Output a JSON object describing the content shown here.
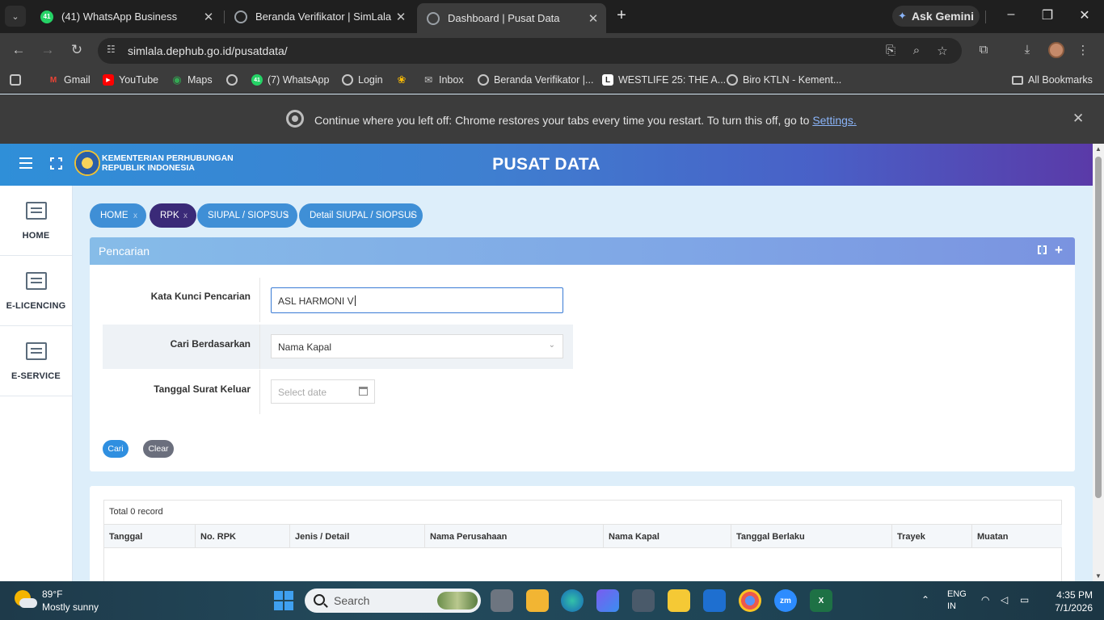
{
  "browser": {
    "tabs": [
      {
        "title": "(41) WhatsApp Business",
        "badge": "41",
        "color": "#25d366",
        "active": false
      },
      {
        "title": "Beranda Verifikator | SimLala",
        "color": "#8c8c8c",
        "active": false
      },
      {
        "title": "Dashboard | Pusat Data",
        "color": "#8c8c8c",
        "active": true
      }
    ],
    "ask_gemini": "Ask Gemini",
    "url": "simlala.dephub.go.id/pusatdata/",
    "bookmarks": [
      {
        "label": "Gmail",
        "icon": "gmail-icon",
        "color": "#ea4335"
      },
      {
        "label": "YouTube",
        "icon": "youtube-icon",
        "color": "#ff0000"
      },
      {
        "label": "Maps",
        "icon": "maps-icon",
        "color": "#34a853"
      },
      {
        "label": "",
        "icon": "globe-icon",
        "color": "#9aa0a6"
      },
      {
        "label": "(7) WhatsApp",
        "icon": "whatsapp-icon",
        "color": "#25d366",
        "badge": "41"
      },
      {
        "label": "Login",
        "icon": "globe-icon",
        "color": "#9aa0a6"
      },
      {
        "label": "",
        "icon": "pinwheel-icon",
        "color": "#fbbc04"
      },
      {
        "label": "Inbox",
        "icon": "mail-icon",
        "color": "#9aa0a6"
      },
      {
        "label": "Beranda Verifikator |...",
        "icon": "globe-icon",
        "color": "#9aa0a6"
      },
      {
        "label": "WESTLIFE 25: THE A...",
        "icon": "l-logo-icon",
        "color": "#ffffff"
      },
      {
        "label": "Biro KTLN - Kement...",
        "icon": "globe-icon",
        "color": "#9aa0a6"
      }
    ],
    "all_bookmarks": "All Bookmarks",
    "infobar": {
      "message": "Continue where you left off: Chrome restores your tabs every time you restart. To turn this off, go to",
      "link": "Settings."
    }
  },
  "site": {
    "brand_line1": "KEMENTERIAN PERHUBUNGAN",
    "brand_line2": "REPUBLIK INDONESIA",
    "title": "PUSAT DATA",
    "sidenav": [
      "HOME",
      "E-LICENCING",
      "E-SERVICE"
    ],
    "breadcrumbs": [
      "HOME",
      "RPK",
      "SIUPAL / SIOPSUS",
      "Detail SIUPAL / SIOPSUS"
    ],
    "breadcrumb_close": "x"
  },
  "search_panel": {
    "title": "Pencarian",
    "keyword_label": "Kata Kunci Pencarian",
    "keyword_value": "ASL HARMONI V",
    "search_by_label": "Cari Berdasarkan",
    "search_by_value": "Nama Kapal",
    "date_label": "Tanggal Surat Keluar",
    "date_placeholder": "Select date",
    "search_button": "Cari",
    "clear_button": "Clear"
  },
  "results": {
    "total": "Total 0 record",
    "columns": [
      "Tanggal",
      "No. RPK",
      "Jenis / Detail",
      "Nama Perusahaan",
      "Nama Kapal",
      "Tanggal Berlaku",
      "Trayek",
      "Muatan"
    ]
  },
  "taskbar": {
    "temp": "89°F",
    "weather": "Mostly sunny",
    "search": "Search",
    "lang1": "ENG",
    "lang2": "IN",
    "time": "4:35 PM",
    "date": "7/1/2026"
  }
}
